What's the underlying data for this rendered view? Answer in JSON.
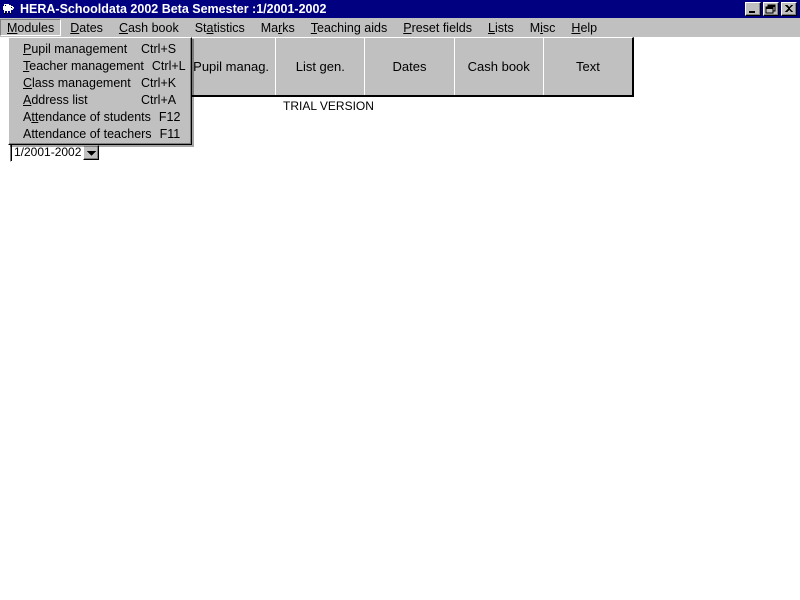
{
  "window": {
    "title": "HERA-Schooldata 2002 Beta Semester :1/2001-2002",
    "icon": "running-figure-icon",
    "title_bar_color": "#000080",
    "face_color": "#c0c0c0",
    "client_color": "#ffffff",
    "controls": [
      {
        "name": "minimize-button",
        "glyph": "minimize"
      },
      {
        "name": "restore-button",
        "glyph": "restore"
      },
      {
        "name": "close-button",
        "glyph": "close"
      }
    ]
  },
  "menubar": {
    "items": [
      {
        "label": "Modules",
        "accel": "M",
        "open": true
      },
      {
        "label": "Dates",
        "accel": "D",
        "open": false
      },
      {
        "label": "Cash book",
        "accel": "C",
        "open": false
      },
      {
        "label": "Statistics",
        "accel": "a",
        "open": false
      },
      {
        "label": "Marks",
        "accel": "r",
        "open": false
      },
      {
        "label": "Teaching aids",
        "accel": "T",
        "open": false
      },
      {
        "label": "Preset fields",
        "accel": "P",
        "open": false
      },
      {
        "label": "Lists",
        "accel": "L",
        "open": false
      },
      {
        "label": "Misc",
        "accel": "i",
        "open": false
      },
      {
        "label": "Help",
        "accel": "H",
        "open": false
      }
    ]
  },
  "modules_menu": {
    "open": true,
    "items": [
      {
        "label": "Pupil management",
        "accel": "P",
        "shortcut": "Ctrl+S"
      },
      {
        "label": "Teacher management",
        "accel": "T",
        "shortcut": "Ctrl+L"
      },
      {
        "label": "Class management",
        "accel": "C",
        "shortcut": "Ctrl+K"
      },
      {
        "label": "Address list",
        "accel": "A",
        "shortcut": "Ctrl+A"
      },
      {
        "label": "Attendance of students",
        "accel": "tt",
        "shortcut": "F12"
      },
      {
        "label": "Attendance of teachers",
        "accel": "",
        "shortcut": "F11"
      }
    ]
  },
  "toolbar": {
    "buttons": [
      {
        "label": "Pupil manag."
      },
      {
        "label": "List gen."
      },
      {
        "label": "Dates"
      },
      {
        "label": "Cash book"
      },
      {
        "label": "Text"
      }
    ]
  },
  "status": {
    "trial_label": "TRIAL VERSION"
  },
  "semester_select": {
    "value": "1/2001-2002",
    "arrow_icon": "chevron-down-icon"
  }
}
